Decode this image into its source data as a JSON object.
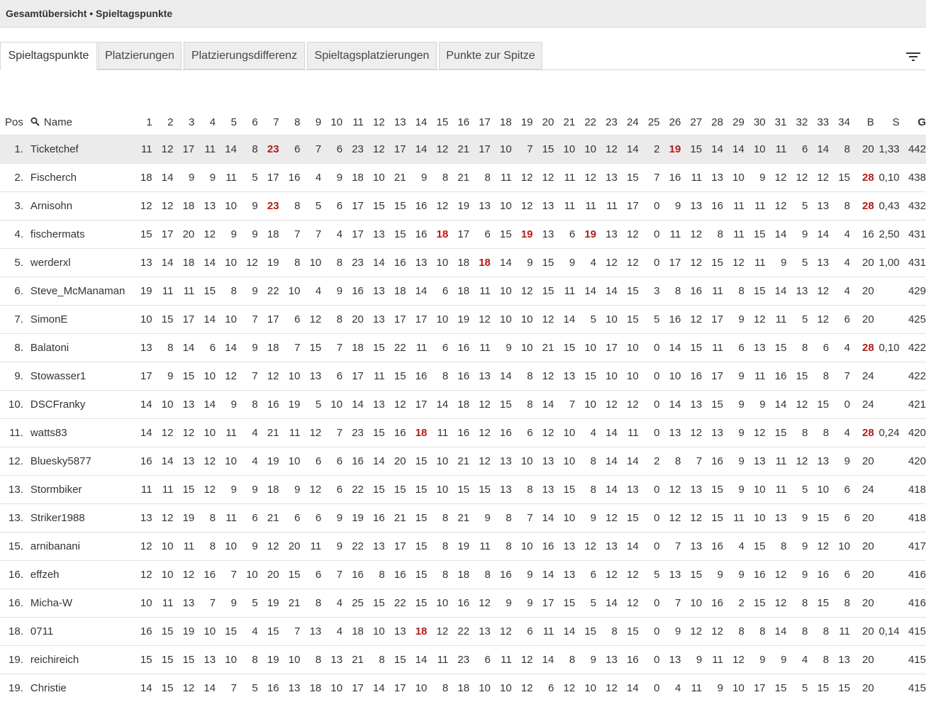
{
  "header": {
    "title": "Gesamtübersicht • Spieltagspunkte"
  },
  "tabs": [
    {
      "label": "Spieltagspunkte",
      "active": true
    },
    {
      "label": "Platzierungen",
      "active": false
    },
    {
      "label": "Platzierungsdifferenz",
      "active": false
    },
    {
      "label": "Spieltagsplatzierungen",
      "active": false
    },
    {
      "label": "Punkte zur Spitze",
      "active": false
    }
  ],
  "icons": {
    "filter": "filter-icon",
    "search": "search-icon"
  },
  "colors": {
    "highlight": "#b31b1b",
    "first_row_bg": "#ebebeb"
  },
  "table": {
    "col_pos": "Pos",
    "col_name": "Name",
    "col_bonus": "B",
    "col_s": "S",
    "col_g": "G",
    "matchdays": [
      "1",
      "2",
      "3",
      "4",
      "5",
      "6",
      "7",
      "8",
      "9",
      "10",
      "11",
      "12",
      "13",
      "14",
      "15",
      "16",
      "17",
      "18",
      "19",
      "20",
      "21",
      "22",
      "23",
      "24",
      "25",
      "26",
      "27",
      "28",
      "29",
      "30",
      "31",
      "32",
      "33",
      "34"
    ],
    "rows": [
      {
        "pos": "1.",
        "name": "Ticketchef",
        "pts": [
          "11",
          "12",
          "17",
          "11",
          "14",
          "8",
          "23",
          "6",
          "7",
          "6",
          "23",
          "12",
          "17",
          "14",
          "12",
          "21",
          "17",
          "10",
          "7",
          "15",
          "10",
          "10",
          "12",
          "14",
          "2",
          "19",
          "15",
          "14",
          "14",
          "10",
          "11",
          "6",
          "14",
          "8"
        ],
        "hi": [
          6,
          25
        ],
        "b": "20",
        "b_hi": false,
        "s": "1,33",
        "g": "442"
      },
      {
        "pos": "2.",
        "name": "Fischerch",
        "pts": [
          "18",
          "14",
          "9",
          "9",
          "11",
          "5",
          "17",
          "16",
          "4",
          "9",
          "18",
          "10",
          "21",
          "9",
          "8",
          "21",
          "8",
          "11",
          "12",
          "12",
          "11",
          "12",
          "13",
          "15",
          "7",
          "16",
          "11",
          "13",
          "10",
          "9",
          "12",
          "12",
          "12",
          "15"
        ],
        "hi": [],
        "b": "28",
        "b_hi": true,
        "s": "0,10",
        "g": "438"
      },
      {
        "pos": "3.",
        "name": "Arnisohn",
        "pts": [
          "12",
          "12",
          "18",
          "13",
          "10",
          "9",
          "23",
          "8",
          "5",
          "6",
          "17",
          "15",
          "15",
          "16",
          "12",
          "19",
          "13",
          "10",
          "12",
          "13",
          "11",
          "11",
          "11",
          "17",
          "0",
          "9",
          "13",
          "16",
          "11",
          "11",
          "12",
          "5",
          "13",
          "8"
        ],
        "hi": [
          6
        ],
        "b": "28",
        "b_hi": true,
        "s": "0,43",
        "g": "432"
      },
      {
        "pos": "4.",
        "name": "fischermats",
        "pts": [
          "15",
          "17",
          "20",
          "12",
          "9",
          "9",
          "18",
          "7",
          "7",
          "4",
          "17",
          "13",
          "15",
          "16",
          "18",
          "17",
          "6",
          "15",
          "19",
          "13",
          "6",
          "19",
          "13",
          "12",
          "0",
          "11",
          "12",
          "8",
          "11",
          "15",
          "14",
          "9",
          "14",
          "4"
        ],
        "hi": [
          14,
          18,
          21
        ],
        "b": "16",
        "b_hi": false,
        "s": "2,50",
        "g": "431"
      },
      {
        "pos": "5.",
        "name": "werderxl",
        "pts": [
          "13",
          "14",
          "18",
          "14",
          "10",
          "12",
          "19",
          "8",
          "10",
          "8",
          "23",
          "14",
          "16",
          "13",
          "10",
          "18",
          "18",
          "14",
          "9",
          "15",
          "9",
          "4",
          "12",
          "12",
          "0",
          "17",
          "12",
          "15",
          "12",
          "11",
          "9",
          "5",
          "13",
          "4"
        ],
        "hi": [
          16
        ],
        "b": "20",
        "b_hi": false,
        "s": "1,00",
        "g": "431"
      },
      {
        "pos": "6.",
        "name": "Steve_McManaman",
        "pts": [
          "19",
          "11",
          "11",
          "15",
          "8",
          "9",
          "22",
          "10",
          "4",
          "9",
          "16",
          "13",
          "18",
          "14",
          "6",
          "18",
          "11",
          "10",
          "12",
          "15",
          "11",
          "14",
          "14",
          "15",
          "3",
          "8",
          "16",
          "11",
          "8",
          "15",
          "14",
          "13",
          "12",
          "4"
        ],
        "hi": [],
        "b": "20",
        "b_hi": false,
        "s": "",
        "g": "429"
      },
      {
        "pos": "7.",
        "name": "SimonE",
        "pts": [
          "10",
          "15",
          "17",
          "14",
          "10",
          "7",
          "17",
          "6",
          "12",
          "8",
          "20",
          "13",
          "17",
          "17",
          "10",
          "19",
          "12",
          "10",
          "10",
          "12",
          "14",
          "5",
          "10",
          "15",
          "5",
          "16",
          "12",
          "17",
          "9",
          "12",
          "11",
          "5",
          "12",
          "6"
        ],
        "hi": [],
        "b": "20",
        "b_hi": false,
        "s": "",
        "g": "425"
      },
      {
        "pos": "8.",
        "name": "Balatoni",
        "pts": [
          "13",
          "8",
          "14",
          "6",
          "14",
          "9",
          "18",
          "7",
          "15",
          "7",
          "18",
          "15",
          "22",
          "11",
          "6",
          "16",
          "11",
          "9",
          "10",
          "21",
          "15",
          "10",
          "17",
          "10",
          "0",
          "14",
          "15",
          "11",
          "6",
          "13",
          "15",
          "8",
          "6",
          "4"
        ],
        "hi": [],
        "b": "28",
        "b_hi": true,
        "s": "0,10",
        "g": "422"
      },
      {
        "pos": "9.",
        "name": "Stowasser1",
        "pts": [
          "17",
          "9",
          "15",
          "10",
          "12",
          "7",
          "12",
          "10",
          "13",
          "6",
          "17",
          "11",
          "15",
          "16",
          "8",
          "16",
          "13",
          "14",
          "8",
          "12",
          "13",
          "15",
          "10",
          "10",
          "0",
          "10",
          "16",
          "17",
          "9",
          "11",
          "16",
          "15",
          "8",
          "7"
        ],
        "hi": [],
        "b": "24",
        "b_hi": false,
        "s": "",
        "g": "422"
      },
      {
        "pos": "10.",
        "name": "DSCFranky",
        "pts": [
          "14",
          "10",
          "13",
          "14",
          "9",
          "8",
          "16",
          "19",
          "5",
          "10",
          "14",
          "13",
          "12",
          "17",
          "14",
          "18",
          "12",
          "15",
          "8",
          "14",
          "7",
          "10",
          "12",
          "12",
          "0",
          "14",
          "13",
          "15",
          "9",
          "9",
          "14",
          "12",
          "15",
          "0"
        ],
        "hi": [],
        "b": "24",
        "b_hi": false,
        "s": "",
        "g": "421"
      },
      {
        "pos": "11.",
        "name": "watts83",
        "pts": [
          "14",
          "12",
          "12",
          "10",
          "11",
          "4",
          "21",
          "11",
          "12",
          "7",
          "23",
          "15",
          "16",
          "18",
          "11",
          "16",
          "12",
          "16",
          "6",
          "12",
          "10",
          "4",
          "14",
          "11",
          "0",
          "13",
          "12",
          "13",
          "9",
          "12",
          "15",
          "8",
          "8",
          "4"
        ],
        "hi": [
          13
        ],
        "b": "28",
        "b_hi": true,
        "s": "0,24",
        "g": "420"
      },
      {
        "pos": "12.",
        "name": "Bluesky5877",
        "pts": [
          "16",
          "14",
          "13",
          "12",
          "10",
          "4",
          "19",
          "10",
          "6",
          "6",
          "16",
          "14",
          "20",
          "15",
          "10",
          "21",
          "12",
          "13",
          "10",
          "13",
          "10",
          "8",
          "14",
          "14",
          "2",
          "8",
          "7",
          "16",
          "9",
          "13",
          "11",
          "12",
          "13",
          "9"
        ],
        "hi": [],
        "b": "20",
        "b_hi": false,
        "s": "",
        "g": "420"
      },
      {
        "pos": "13.",
        "name": "Stormbiker",
        "pts": [
          "11",
          "11",
          "15",
          "12",
          "9",
          "9",
          "18",
          "9",
          "12",
          "6",
          "22",
          "15",
          "15",
          "15",
          "10",
          "15",
          "15",
          "13",
          "8",
          "13",
          "15",
          "8",
          "14",
          "13",
          "0",
          "12",
          "13",
          "15",
          "9",
          "10",
          "11",
          "5",
          "10",
          "6"
        ],
        "hi": [],
        "b": "24",
        "b_hi": false,
        "s": "",
        "g": "418"
      },
      {
        "pos": "13.",
        "name": "Striker1988",
        "pts": [
          "13",
          "12",
          "19",
          "8",
          "11",
          "6",
          "21",
          "6",
          "6",
          "9",
          "19",
          "16",
          "21",
          "15",
          "8",
          "21",
          "9",
          "8",
          "7",
          "14",
          "10",
          "9",
          "12",
          "15",
          "0",
          "12",
          "12",
          "15",
          "11",
          "10",
          "13",
          "9",
          "15",
          "6"
        ],
        "hi": [],
        "b": "20",
        "b_hi": false,
        "s": "",
        "g": "418"
      },
      {
        "pos": "15.",
        "name": "arnibanani",
        "pts": [
          "12",
          "10",
          "11",
          "8",
          "10",
          "9",
          "12",
          "20",
          "11",
          "9",
          "22",
          "13",
          "17",
          "15",
          "8",
          "19",
          "11",
          "8",
          "10",
          "16",
          "13",
          "12",
          "13",
          "14",
          "0",
          "7",
          "13",
          "16",
          "4",
          "15",
          "8",
          "9",
          "12",
          "10"
        ],
        "hi": [],
        "b": "20",
        "b_hi": false,
        "s": "",
        "g": "417"
      },
      {
        "pos": "16.",
        "name": "effzeh",
        "pts": [
          "12",
          "10",
          "12",
          "16",
          "7",
          "10",
          "20",
          "15",
          "6",
          "7",
          "16",
          "8",
          "16",
          "15",
          "8",
          "18",
          "8",
          "16",
          "9",
          "14",
          "13",
          "6",
          "12",
          "12",
          "5",
          "13",
          "15",
          "9",
          "9",
          "16",
          "12",
          "9",
          "16",
          "6"
        ],
        "hi": [],
        "b": "20",
        "b_hi": false,
        "s": "",
        "g": "416"
      },
      {
        "pos": "16.",
        "name": "Micha-W",
        "pts": [
          "10",
          "11",
          "13",
          "7",
          "9",
          "5",
          "19",
          "21",
          "8",
          "4",
          "25",
          "15",
          "22",
          "15",
          "10",
          "16",
          "12",
          "9",
          "9",
          "17",
          "15",
          "5",
          "14",
          "12",
          "0",
          "7",
          "10",
          "16",
          "2",
          "15",
          "12",
          "8",
          "15",
          "8"
        ],
        "hi": [],
        "b": "20",
        "b_hi": false,
        "s": "",
        "g": "416"
      },
      {
        "pos": "18.",
        "name": "0711",
        "pts": [
          "16",
          "15",
          "19",
          "10",
          "15",
          "4",
          "15",
          "7",
          "13",
          "4",
          "18",
          "10",
          "13",
          "18",
          "12",
          "22",
          "13",
          "12",
          "6",
          "11",
          "14",
          "15",
          "8",
          "15",
          "0",
          "9",
          "12",
          "12",
          "8",
          "8",
          "14",
          "8",
          "8",
          "11"
        ],
        "hi": [
          13
        ],
        "b": "20",
        "b_hi": false,
        "s": "0,14",
        "g": "415"
      },
      {
        "pos": "19.",
        "name": "reichireich",
        "pts": [
          "15",
          "15",
          "15",
          "13",
          "10",
          "8",
          "19",
          "10",
          "8",
          "13",
          "21",
          "8",
          "15",
          "14",
          "11",
          "23",
          "6",
          "11",
          "12",
          "14",
          "8",
          "9",
          "13",
          "16",
          "0",
          "13",
          "9",
          "11",
          "12",
          "9",
          "9",
          "4",
          "8",
          "13"
        ],
        "hi": [],
        "b": "20",
        "b_hi": false,
        "s": "",
        "g": "415"
      },
      {
        "pos": "19.",
        "name": "Christie",
        "pts": [
          "14",
          "15",
          "12",
          "14",
          "7",
          "5",
          "16",
          "13",
          "18",
          "10",
          "17",
          "14",
          "17",
          "10",
          "8",
          "18",
          "10",
          "10",
          "12",
          "6",
          "12",
          "10",
          "12",
          "14",
          "0",
          "4",
          "11",
          "9",
          "10",
          "17",
          "15",
          "5",
          "15",
          "15"
        ],
        "hi": [],
        "b": "20",
        "b_hi": false,
        "s": "",
        "g": "415"
      }
    ]
  }
}
